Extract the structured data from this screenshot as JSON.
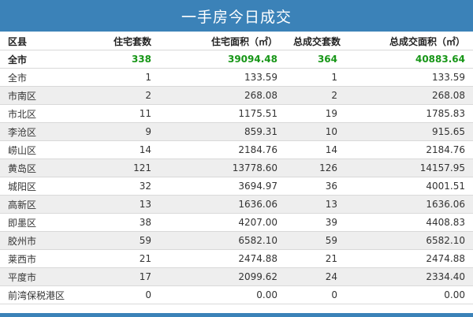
{
  "title": "一手房今日成交",
  "headers": [
    "区县",
    "住宅套数",
    "住宅面积（㎡）",
    "总成交套数",
    "总成交面积（㎡）"
  ],
  "total": {
    "name": "全市",
    "units": "338",
    "area": "39094.48",
    "total_units": "364",
    "total_area": "40883.64"
  },
  "rows": [
    {
      "name": "全市",
      "units": "1",
      "area": "133.59",
      "total_units": "1",
      "total_area": "133.59"
    },
    {
      "name": "市南区",
      "units": "2",
      "area": "268.08",
      "total_units": "2",
      "total_area": "268.08"
    },
    {
      "name": "市北区",
      "units": "11",
      "area": "1175.51",
      "total_units": "19",
      "total_area": "1785.83"
    },
    {
      "name": "李沧区",
      "units": "9",
      "area": "859.31",
      "total_units": "10",
      "total_area": "915.65"
    },
    {
      "name": "崂山区",
      "units": "14",
      "area": "2184.76",
      "total_units": "14",
      "total_area": "2184.76"
    },
    {
      "name": "黄岛区",
      "units": "121",
      "area": "13778.60",
      "total_units": "126",
      "total_area": "14157.95"
    },
    {
      "name": "城阳区",
      "units": "32",
      "area": "3694.97",
      "total_units": "36",
      "total_area": "4001.51"
    },
    {
      "name": "高新区",
      "units": "13",
      "area": "1636.06",
      "total_units": "13",
      "total_area": "1636.06"
    },
    {
      "name": "即墨区",
      "units": "38",
      "area": "4207.00",
      "total_units": "39",
      "total_area": "4408.83"
    },
    {
      "name": "胶州市",
      "units": "59",
      "area": "6582.10",
      "total_units": "59",
      "total_area": "6582.10"
    },
    {
      "name": "莱西市",
      "units": "21",
      "area": "2474.88",
      "total_units": "21",
      "total_area": "2474.88"
    },
    {
      "name": "平度市",
      "units": "17",
      "area": "2099.62",
      "total_units": "24",
      "total_area": "2334.40"
    },
    {
      "name": "前湾保税港区",
      "units": "0",
      "area": "0.00",
      "total_units": "0",
      "total_area": "0.00"
    }
  ],
  "colors": {
    "header_bar": "#3b82b8",
    "total_values": "#179617",
    "stripe": "#eeeeee"
  }
}
